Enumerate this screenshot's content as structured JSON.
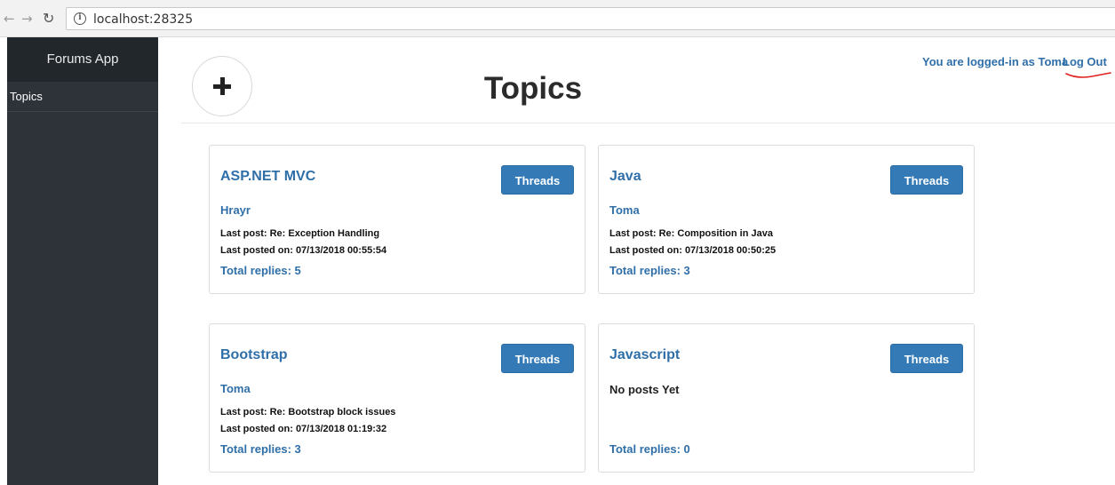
{
  "browser": {
    "back_glyph": "←",
    "forward_glyph": "→",
    "reload_glyph": "↻",
    "url": "localhost:28325"
  },
  "sidebar": {
    "brand": "Forums App",
    "items": [
      {
        "label": "Topics"
      }
    ]
  },
  "header": {
    "title": "Topics",
    "user_text": "You are logged-in as Toma",
    "logout_label": "Log Out",
    "annotation_color": "#e0201f"
  },
  "topics": [
    {
      "title": "ASP.NET MVC",
      "threads_label": "Threads",
      "author": "Hrayr",
      "last_post": "Last post: Re: Exception Handling",
      "last_posted_on": "Last posted on: 07/13/2018 00:55:54",
      "total_replies": "Total replies: 5"
    },
    {
      "title": "Java",
      "threads_label": "Threads",
      "author": "Toma",
      "last_post": "Last post: Re: Composition in Java",
      "last_posted_on": "Last posted on: 07/13/2018 00:50:25",
      "total_replies": "Total replies: 3"
    },
    {
      "title": "Bootstrap",
      "threads_label": "Threads",
      "author": "Toma",
      "last_post": "Last post: Re: Bootstrap block issues",
      "last_posted_on": "Last posted on: 07/13/2018 01:19:32",
      "total_replies": "Total replies: 3"
    },
    {
      "title": "Javascript",
      "threads_label": "Threads",
      "no_posts": "No posts Yet",
      "total_replies": "Total replies: 0"
    }
  ],
  "colors": {
    "accent": "#337ab7",
    "link": "#2f6fa8",
    "sidebar_bg": "#2d3339"
  }
}
